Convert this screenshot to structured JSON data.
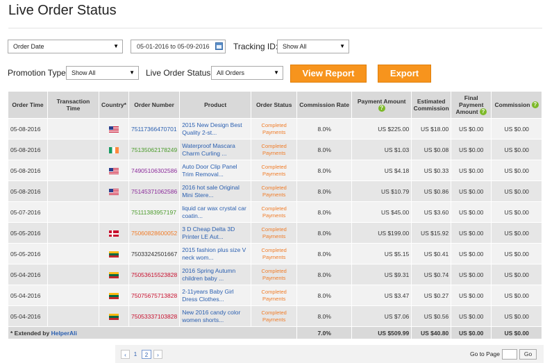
{
  "page": {
    "title": "Live Order Status"
  },
  "filters": {
    "order_date_select": "Order Date",
    "date_range": "05-01-2016 to 05-09-2016",
    "tracking_label": "Tracking ID:",
    "tracking_value": "Show All",
    "promotion_label": "Promotion Type:",
    "promotion_value": "Show All",
    "status_label": "Live Order Status:",
    "status_value": "All Orders",
    "view_report": "View Report",
    "export": "Export"
  },
  "table": {
    "headers": {
      "order_time": "Order Time",
      "transaction_time": "Transaction Time",
      "country": "Country*",
      "order_number": "Order Number",
      "product": "Product",
      "order_status": "Order Status",
      "commission_rate": "Commission Rate",
      "payment_amount": "Payment Amount",
      "estimated_commission": "Estimated Commission",
      "final_payment_amount": "Final Payment Amount",
      "commission": "Commission"
    },
    "rows": [
      {
        "order_time": "05-08-2016",
        "transaction_time": "",
        "country": "us",
        "order_number": "75117366470701",
        "order_color": "#2a5fb0",
        "product": "2015 New Design Best Quality 2-st...",
        "status": "Completed Payments",
        "rate": "8.0%",
        "payment": "US $225.00",
        "estimated": "US $18.00",
        "final": "US $0.00",
        "commission": "US $0.00"
      },
      {
        "order_time": "05-08-2016",
        "transaction_time": "",
        "country": "ie",
        "order_number": "75135062178249",
        "order_color": "#4a9a2a",
        "product": "Waterproof Mascara Charm Curling ...",
        "status": "Completed Payments",
        "rate": "8.0%",
        "payment": "US $1.03",
        "estimated": "US $0.08",
        "final": "US $0.00",
        "commission": "US $0.00"
      },
      {
        "order_time": "05-08-2016",
        "transaction_time": "",
        "country": "us",
        "order_number": "74905106302586",
        "order_color": "#8a2a9a",
        "product": "Auto Door Clip Panel Trim Removal...",
        "status": "Completed Payments",
        "rate": "8.0%",
        "payment": "US $4.18",
        "estimated": "US $0.33",
        "final": "US $0.00",
        "commission": "US $0.00"
      },
      {
        "order_time": "05-08-2016",
        "transaction_time": "",
        "country": "us",
        "order_number": "75145371062586",
        "order_color": "#8a2a9a",
        "product": "2016 hot sale Original Mini Stere...",
        "status": "Completed Payments",
        "rate": "8.0%",
        "payment": "US $10.79",
        "estimated": "US $0.86",
        "final": "US $0.00",
        "commission": "US $0.00"
      },
      {
        "order_time": "05-07-2016",
        "transaction_time": "",
        "country": "",
        "order_number": "75111383957197",
        "order_color": "#4a9a2a",
        "product": "liquid car wax crystal car coatin...",
        "status": "Completed Payments",
        "rate": "8.0%",
        "payment": "US $45.00",
        "estimated": "US $3.60",
        "final": "US $0.00",
        "commission": "US $0.00"
      },
      {
        "order_time": "05-05-2016",
        "transaction_time": "",
        "country": "dk",
        "order_number": "75060828600052",
        "order_color": "#f07c28",
        "product": "3 D Cheap Delta 3D Printer LE Aut...",
        "status": "Completed Payments",
        "rate": "8.0%",
        "payment": "US $199.00",
        "estimated": "US $15.92",
        "final": "US $0.00",
        "commission": "US $0.00"
      },
      {
        "order_time": "05-05-2016",
        "transaction_time": "",
        "country": "lt",
        "order_number": "75033242501667",
        "order_color": "#333333",
        "product": "2015 fashion plus size V neck wom...",
        "status": "Completed Payments",
        "rate": "8.0%",
        "payment": "US $5.15",
        "estimated": "US $0.41",
        "final": "US $0.00",
        "commission": "US $0.00"
      },
      {
        "order_time": "05-04-2016",
        "transaction_time": "",
        "country": "lt",
        "order_number": "75053615523828",
        "order_color": "#c8102e",
        "product": "2016 Spring Autumn children baby ...",
        "status": "Completed Payments",
        "rate": "8.0%",
        "payment": "US $9.31",
        "estimated": "US $0.74",
        "final": "US $0.00",
        "commission": "US $0.00"
      },
      {
        "order_time": "05-04-2016",
        "transaction_time": "",
        "country": "lt",
        "order_number": "75075675713828",
        "order_color": "#c8102e",
        "product": "2-11years Baby Girl Dress Clothes...",
        "status": "Completed Payments",
        "rate": "8.0%",
        "payment": "US $3.47",
        "estimated": "US $0.27",
        "final": "US $0.00",
        "commission": "US $0.00"
      },
      {
        "order_time": "05-04-2016",
        "transaction_time": "",
        "country": "lt",
        "order_number": "75053337103828",
        "order_color": "#c8102e",
        "product": "New 2016 candy color women shorts...",
        "status": "Completed Payments",
        "rate": "8.0%",
        "payment": "US $7.06",
        "estimated": "US $0.56",
        "final": "US $0.00",
        "commission": "US $0.00"
      }
    ],
    "footer": {
      "extended_prefix": "* Extended by ",
      "extended_by": "HelperAli",
      "rate": "7.0%",
      "payment": "US $509.99",
      "estimated": "US $40.80",
      "final": "US $0.00",
      "commission": "US $0.00"
    }
  },
  "pagination": {
    "prev": "‹",
    "pages": [
      "1",
      "2"
    ],
    "current": "2",
    "next": "›",
    "goto_label": "Go to Page",
    "go_button": "Go"
  }
}
